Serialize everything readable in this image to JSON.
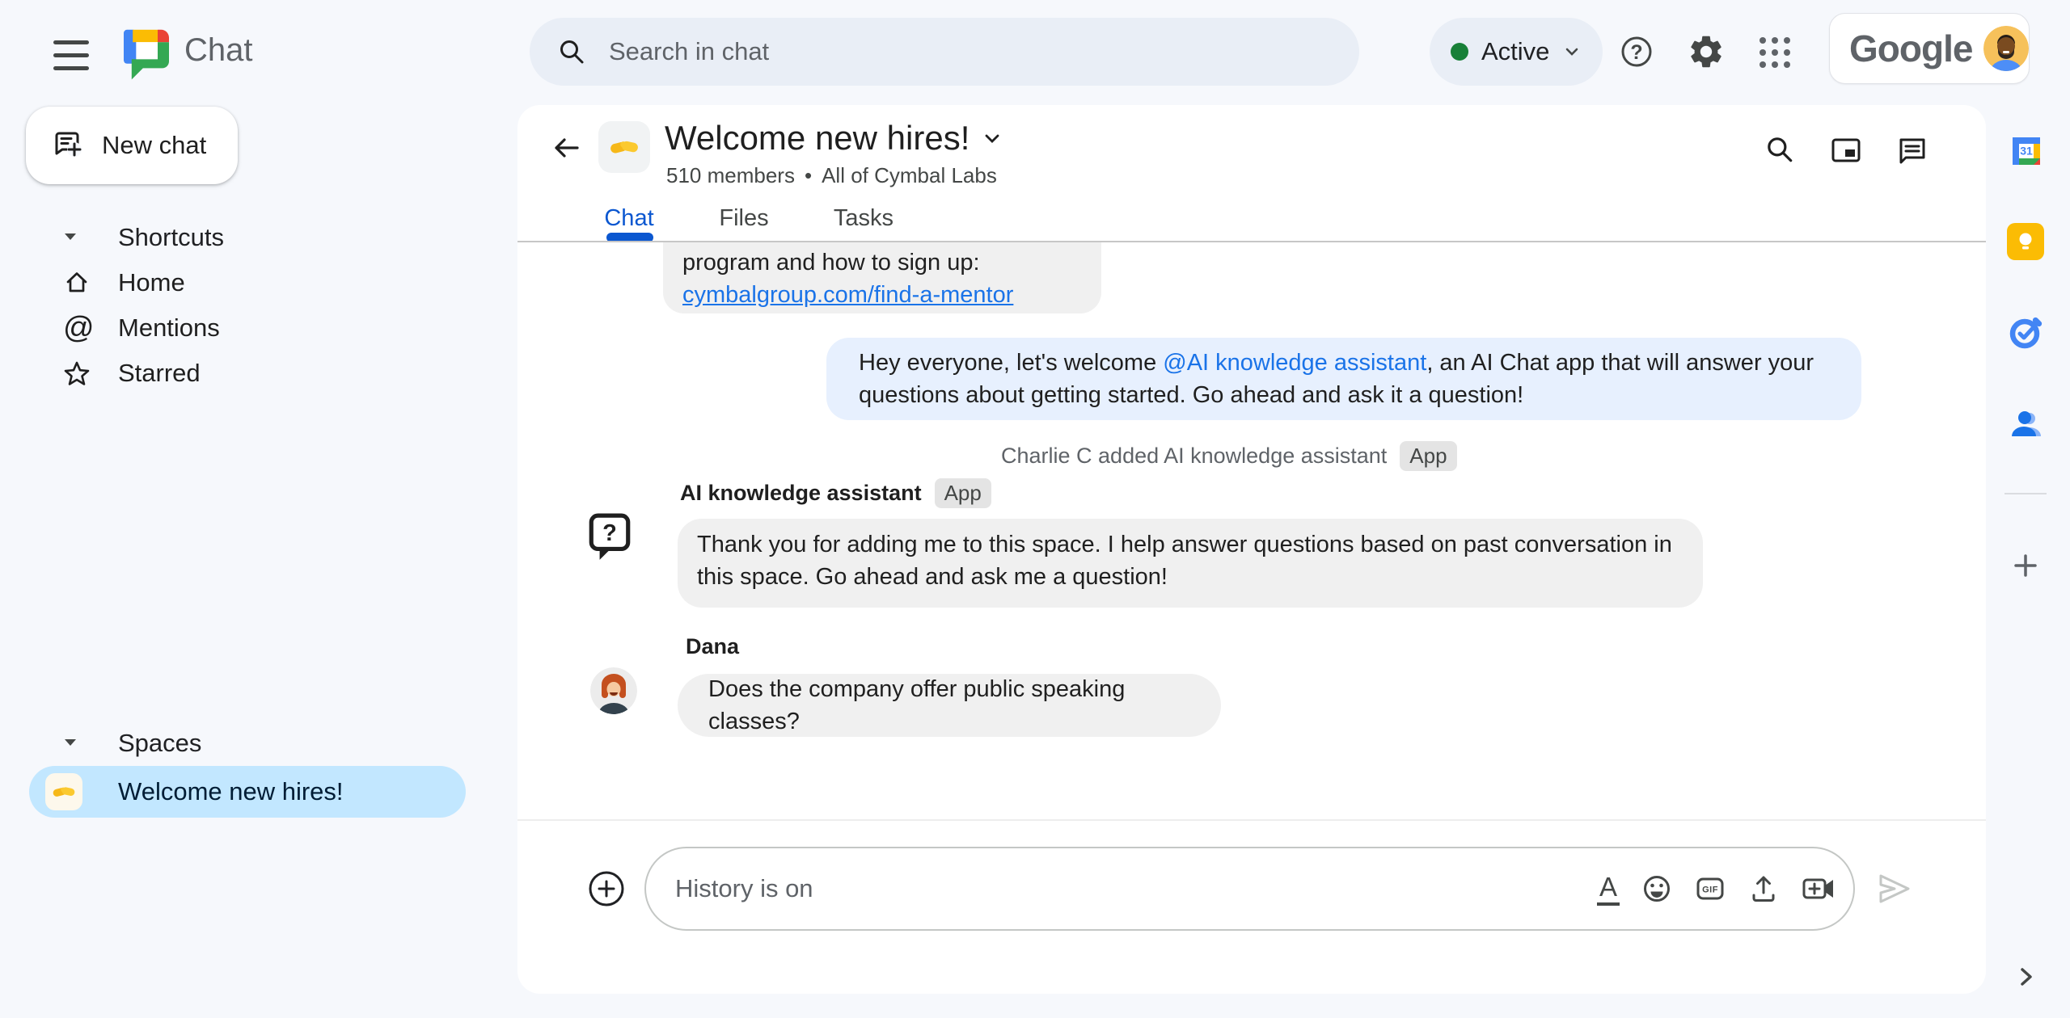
{
  "topbar": {
    "app_name": "Chat",
    "search_placeholder": "Search in chat",
    "status_label": "Active",
    "brand": "Google"
  },
  "sidebar": {
    "new_chat_label": "New chat",
    "shortcuts_header": "Shortcuts",
    "shortcut_items": [
      {
        "label": "Home"
      },
      {
        "label": "Mentions"
      },
      {
        "label": "Starred"
      }
    ],
    "spaces_header": "Spaces",
    "space_item_label": "Welcome new hires!"
  },
  "space_header": {
    "title": "Welcome new hires!",
    "members": "510 members",
    "dot": "•",
    "org": "All of Cymbal Labs",
    "tabs": [
      {
        "label": "Chat",
        "active": true
      },
      {
        "label": "Files",
        "active": false
      },
      {
        "label": "Tasks",
        "active": false
      }
    ]
  },
  "messages": {
    "clipped": {
      "text": "program and how to sign up:",
      "link": "cymbalgroup.com/find-a-mentor"
    },
    "announcement": {
      "prefix": "Hey everyone, let's welcome ",
      "mention": "@AI knowledge assistant",
      "rest": ", an AI Chat app that will answer your questions about getting started.  Go ahead and ask it a question!"
    },
    "system_event": {
      "text": "Charlie C added AI knowledge assistant",
      "badge": "App"
    },
    "bot": {
      "sender": "AI knowledge assistant",
      "badge": "App",
      "text": "Thank you for adding me to this space. I help answer questions based on past conversation in this space. Go ahead and ask me a question!"
    },
    "user": {
      "sender": "Dana",
      "text": "Does the company offer public speaking classes?"
    }
  },
  "composer": {
    "placeholder": "History is on"
  },
  "icons": {
    "hamburger-icon": "three horizontal bars",
    "chat-logo": "google chat speech bubble",
    "search-icon": "magnifier",
    "status-dot": "green circle",
    "chevron-down-icon": "v chevron",
    "help-icon": "question mark in circle",
    "settings-icon": "gear",
    "apps-grid-icon": "3x3 dots",
    "avatar": "profile picture",
    "new-chat-icon": "speech bubble with plus",
    "home-icon": "house outline",
    "mentions-icon": "@ sign",
    "starred-icon": "star outline",
    "handshake-icon": "handshake emoji",
    "back-arrow-icon": "left arrow",
    "pip-icon": "picture in picture",
    "thread-icon": "message bubble with lines",
    "question-bubble-icon": "speech bubble with question mark",
    "plus-circle-icon": "plus in circle",
    "format-icon": "underlined A",
    "emoji-icon": "smiley face",
    "gif-icon": "GIF box",
    "upload-icon": "arrow up from tray",
    "video-icon": "camera with plus",
    "send-icon": "paper plane outline",
    "calendar-icon": "google calendar 31",
    "keep-icon": "google keep bulb",
    "tasks-icon": "google tasks check",
    "contacts-icon": "google contacts person",
    "plus-icon": "plus",
    "chevron-right-icon": "right chevron"
  },
  "colors": {
    "app_bg": "#f6f8fc",
    "card_bg": "#ffffff",
    "accent_blue": "#0b57d0",
    "link_blue": "#1a73e8",
    "selected_pill": "#c2e7ff",
    "status_green": "#188038",
    "bubble_gray": "#f0f0f0",
    "bubble_blue": "#e7f0fe",
    "pill_gray": "#e9eef6",
    "text_primary": "#1f1f1f",
    "text_secondary": "#5f6368"
  }
}
